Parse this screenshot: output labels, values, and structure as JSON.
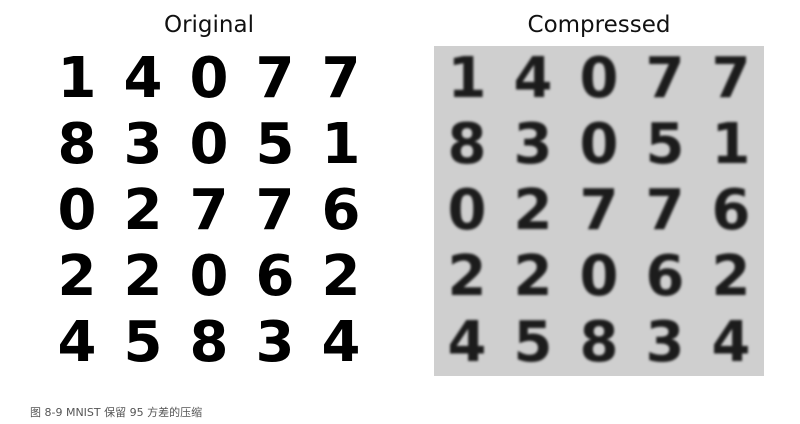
{
  "panels": [
    {
      "title": "Original"
    },
    {
      "title": "Compressed"
    }
  ],
  "digits": [
    [
      "1",
      "4",
      "0",
      "7",
      "7"
    ],
    [
      "8",
      "3",
      "0",
      "5",
      "1"
    ],
    [
      "0",
      "2",
      "7",
      "7",
      "6"
    ],
    [
      "2",
      "2",
      "0",
      "6",
      "2"
    ],
    [
      "4",
      "5",
      "8",
      "3",
      "4"
    ]
  ],
  "caption": "图 8-9 MNIST 保留 95 方差的压缩"
}
